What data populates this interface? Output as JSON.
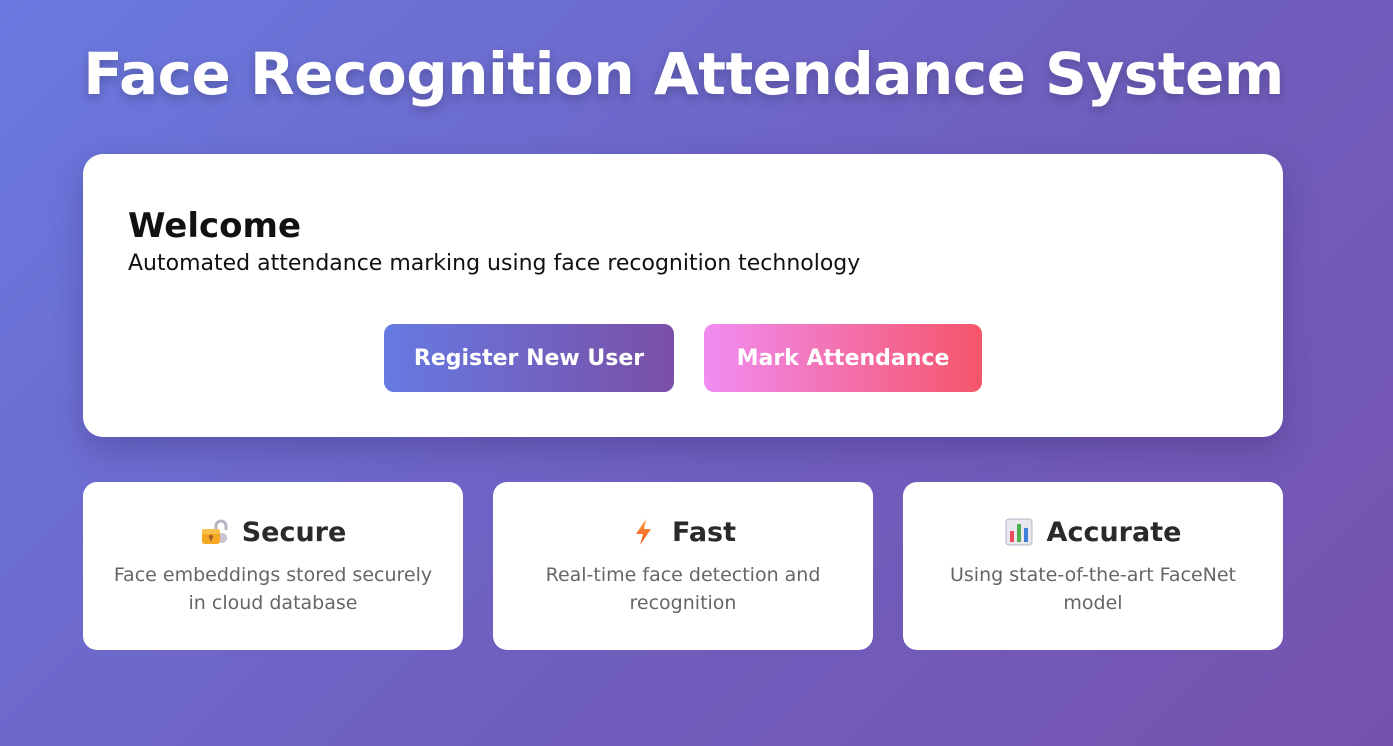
{
  "header": {
    "title": "Face Recognition Attendance System"
  },
  "welcome": {
    "heading": "Welcome",
    "subtitle": "Automated attendance marking using face recognition technology",
    "buttons": {
      "register_label": "Register New User",
      "attendance_label": "Mark Attendance"
    }
  },
  "features": [
    {
      "icon": "lock-icon",
      "title": "Secure",
      "description": "Face embeddings stored securely in cloud database"
    },
    {
      "icon": "lightning-icon",
      "title": "Fast",
      "description": "Real-time face detection and recognition"
    },
    {
      "icon": "bar-chart-icon",
      "title": "Accurate",
      "description": "Using state-of-the-art FaceNet model"
    }
  ],
  "colors": {
    "background_start": "#6a7ae0",
    "background_end": "#7652ae",
    "register_button_start": "#667ae2",
    "register_button_end": "#7a4fa7",
    "attendance_button_start": "#f18cf2",
    "attendance_button_end": "#f55569"
  }
}
